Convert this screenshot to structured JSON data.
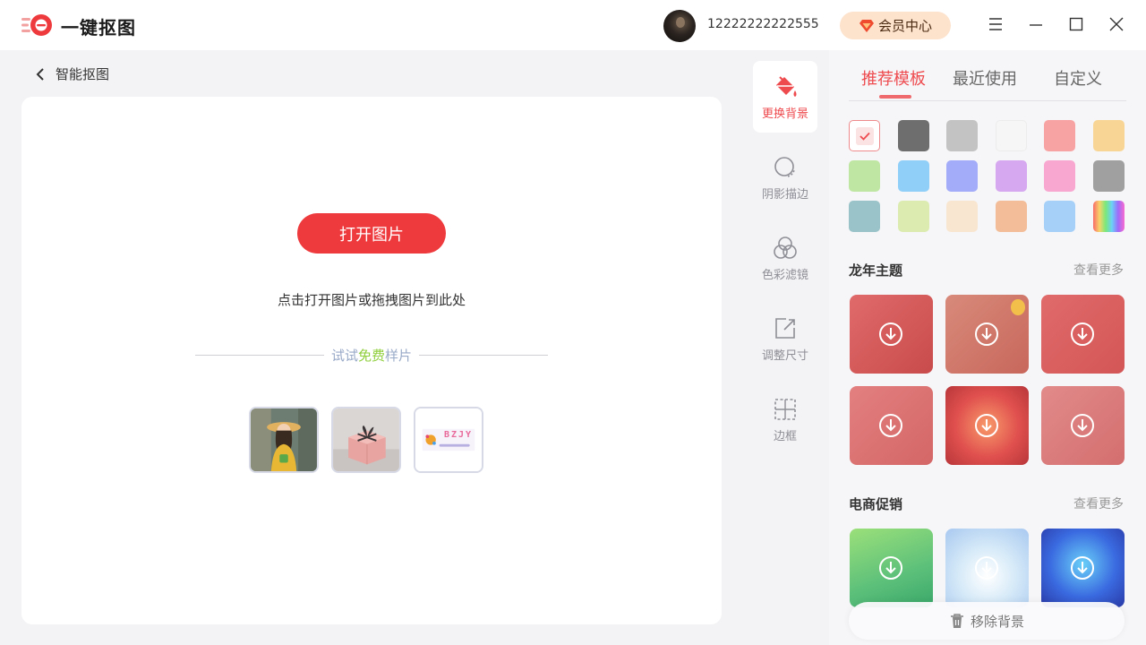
{
  "app": {
    "title": "一键抠图"
  },
  "header": {
    "username": "12222222222555",
    "vip_label": "会员中心"
  },
  "nav": {
    "back_label": "智能抠图"
  },
  "canvas": {
    "open_button": "打开图片",
    "hint": "点击打开图片或拖拽图片到此处",
    "sample_prefix": "试试",
    "sample_highlight": "免费",
    "sample_suffix": "样片",
    "sample_logo_text": "BZJY"
  },
  "tools": [
    {
      "label": "更换背景",
      "icon": "paint-bucket-icon",
      "active": true
    },
    {
      "label": "阴影描边",
      "icon": "shadow-outline-icon",
      "active": false
    },
    {
      "label": "色彩滤镜",
      "icon": "color-filter-icon",
      "active": false
    },
    {
      "label": "调整尺寸",
      "icon": "resize-icon",
      "active": false
    },
    {
      "label": "边框",
      "icon": "border-icon",
      "active": false
    }
  ],
  "panel": {
    "tabs": [
      "推荐模板",
      "最近使用",
      "自定义"
    ],
    "active_tab": "推荐模板",
    "swatches": [
      "transparent",
      "#6e6e6e",
      "#c3c3c3",
      "#f6f6f6",
      "#f8a3a3",
      "#f8d595",
      "#c0e6a3",
      "#8fcff8",
      "#a3acf8",
      "#d6a8ef",
      "#f8a8d0",
      "#a0a0a0",
      "#99c3c8",
      "#dcecb0",
      "#f8e6d0",
      "#f2bd98",
      "#a6d0f8",
      "rainbow"
    ],
    "sections": [
      {
        "title": "龙年主题",
        "more": "查看更多"
      },
      {
        "title": "电商促销",
        "more": "查看更多"
      }
    ],
    "remove_label": "移除背景"
  },
  "colors": {
    "accent": "#ee3a3d",
    "vip_bg": "#fde2cc",
    "sample_highlight": "#8fcf3c"
  }
}
